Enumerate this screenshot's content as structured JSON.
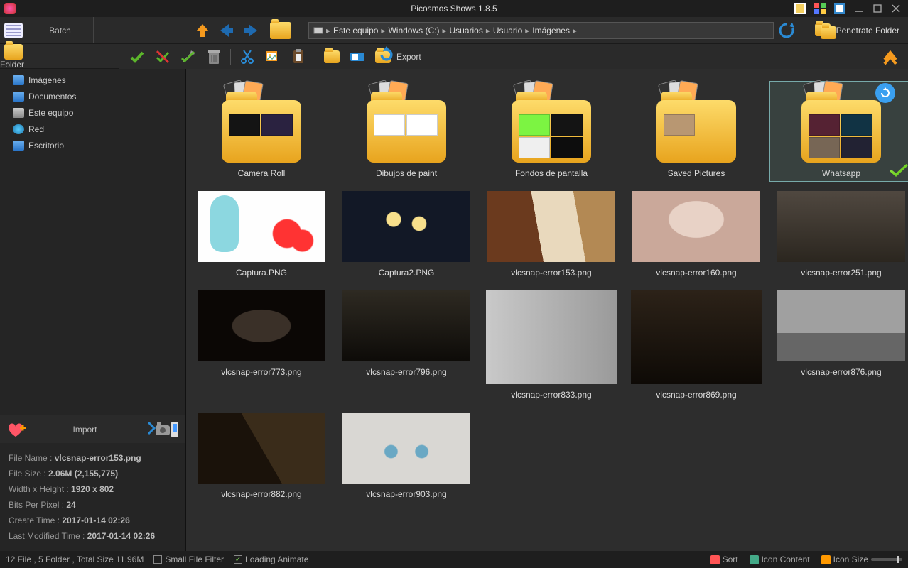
{
  "app": {
    "title": "Picosmos Shows 1.8.5"
  },
  "top_buttons": {
    "batch": "Batch",
    "folder": "Folder"
  },
  "breadcrumb": [
    "Este equipo",
    "Windows (C:)",
    "Usuarios",
    "Usuario",
    "Imágenes"
  ],
  "penetrate_label": "Penetrate Folder",
  "toolbar": {
    "export": "Export"
  },
  "tree": [
    {
      "label": "Imágenes",
      "icon": "ic-folder"
    },
    {
      "label": "Documentos",
      "icon": "ic-folder"
    },
    {
      "label": "Este equipo",
      "icon": "ic-disk"
    },
    {
      "label": "Red",
      "icon": "ic-net"
    },
    {
      "label": "Escritorio",
      "icon": "ic-folder"
    }
  ],
  "import": {
    "label": "Import"
  },
  "meta": {
    "file_name_label": "File Name :",
    "file_name": "vlcsnap-error153.png",
    "file_size_label": "File Size :",
    "file_size": "2.06M (2,155,775)",
    "dims_label": "Width x Height :",
    "dims": "1920 x 802",
    "bpp_label": "Bits Per Pixel :",
    "bpp": "24",
    "ctime_label": "Create Time :",
    "ctime": "2017-01-14 02:26",
    "mtime_label": "Last Modified Time :",
    "mtime": "2017-01-14 02:26"
  },
  "folders": [
    {
      "name": "Camera Roll",
      "previews": [
        "fp-1a",
        "fp-1b"
      ]
    },
    {
      "name": "Dibujos de paint",
      "previews": [
        "fp-2a",
        "fp-2b"
      ]
    },
    {
      "name": "Fondos de pantalla",
      "previews": [
        "fp-3a",
        "fp-3b",
        "fp-3c",
        "fp-3d"
      ]
    },
    {
      "name": "Saved Pictures",
      "previews": [
        "fp-4a"
      ]
    },
    {
      "name": "Whatsapp",
      "previews": [
        "fp-5a",
        "fp-5b",
        "fp-5c",
        "fp-5d"
      ],
      "selected": true
    }
  ],
  "images": [
    {
      "name": "Captura.PNG",
      "cls": "th-a"
    },
    {
      "name": "Captura2.PNG",
      "cls": "th-b"
    },
    {
      "name": "vlcsnap-error153.png",
      "cls": "th-c"
    },
    {
      "name": "vlcsnap-error160.png",
      "cls": "th-d"
    },
    {
      "name": "vlcsnap-error251.png",
      "cls": "th-e"
    },
    {
      "name": "vlcsnap-error773.png",
      "cls": "th-f"
    },
    {
      "name": "vlcsnap-error796.png",
      "cls": "th-g"
    },
    {
      "name": "vlcsnap-error833.png",
      "cls": "th-h",
      "tall": true
    },
    {
      "name": "vlcsnap-error869.png",
      "cls": "th-i",
      "tall": true
    },
    {
      "name": "vlcsnap-error876.png",
      "cls": "th-j"
    },
    {
      "name": "vlcsnap-error882.png",
      "cls": "th-k"
    },
    {
      "name": "vlcsnap-error903.png",
      "cls": "th-l"
    }
  ],
  "status": {
    "summary": "12 File , 5 Folder , Total Size 11.96M",
    "small_filter": "Small File Filter",
    "loading_anim": "Loading Animate",
    "loading_anim_checked": true,
    "sort": "Sort",
    "icon_content": "Icon Content",
    "icon_size": "Icon Size"
  }
}
